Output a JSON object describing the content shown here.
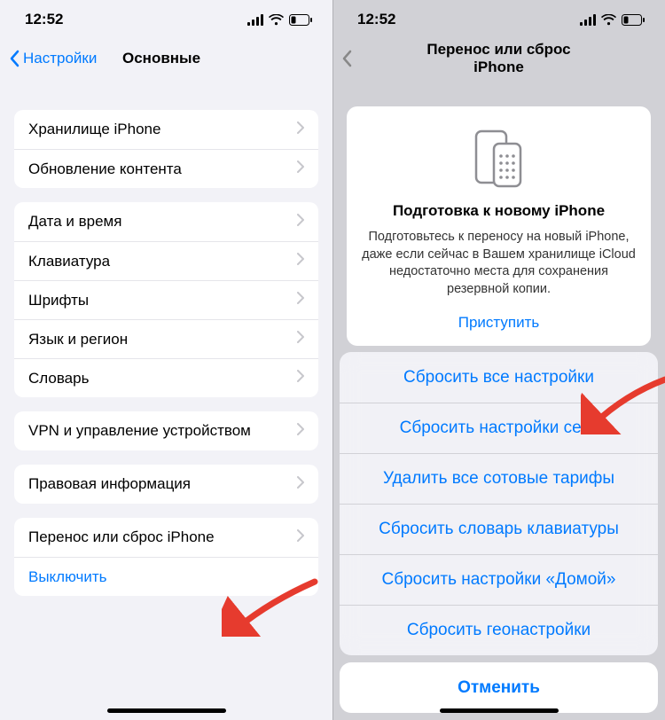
{
  "left": {
    "time": "12:52",
    "back_label": "Настройки",
    "title": "Основные",
    "groups": [
      {
        "rows": [
          {
            "label": "Хранилище iPhone",
            "chevron": true
          },
          {
            "label": "Обновление контента",
            "chevron": true
          }
        ]
      },
      {
        "rows": [
          {
            "label": "Дата и время",
            "chevron": true
          },
          {
            "label": "Клавиатура",
            "chevron": true
          },
          {
            "label": "Шрифты",
            "chevron": true
          },
          {
            "label": "Язык и регион",
            "chevron": true
          },
          {
            "label": "Словарь",
            "chevron": true
          }
        ]
      },
      {
        "rows": [
          {
            "label": "VPN и управление устройством",
            "chevron": true
          }
        ]
      },
      {
        "rows": [
          {
            "label": "Правовая информация",
            "chevron": true
          }
        ]
      },
      {
        "rows": [
          {
            "label": "Перенос или сброс iPhone",
            "chevron": true
          },
          {
            "label": "Выключить",
            "chevron": false,
            "link": true
          }
        ]
      }
    ]
  },
  "right": {
    "time": "12:52",
    "title": "Перенос или сброс iPhone",
    "card": {
      "title": "Подготовка к новому iPhone",
      "body": "Подготовьтесь к переносу на новый iPhone, даже если сейчас в Вашем хранилище iCloud недостаточно места для сохранения резервной копии.",
      "cta": "Приступить"
    },
    "sheet": [
      "Сбросить все настройки",
      "Сбросить настройки сети",
      "Удалить все сотовые тарифы",
      "Сбросить словарь клавиатуры",
      "Сбросить настройки «Домой»",
      "Сбросить геонастройки"
    ],
    "cancel": "Отменить"
  }
}
